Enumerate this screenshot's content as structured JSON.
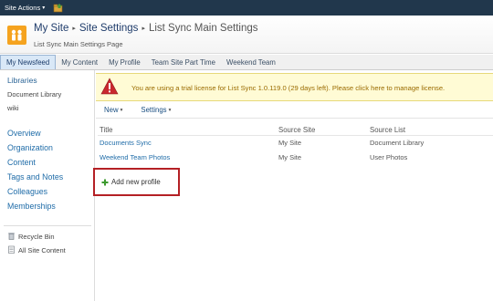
{
  "ribbon": {
    "site_actions": "Site Actions",
    "caret": "▾"
  },
  "header": {
    "breadcrumb": [
      "My Site",
      "Site Settings",
      "List Sync Main Settings"
    ],
    "separator": "▸",
    "subtitle": "List Sync Main Settings Page"
  },
  "topnav": {
    "tabs": [
      {
        "label": "My Newsfeed",
        "selected": true
      },
      {
        "label": "My Content",
        "selected": false
      },
      {
        "label": "My Profile",
        "selected": false
      },
      {
        "label": "Team Site Part Time",
        "selected": false
      },
      {
        "label": "Weekend Team",
        "selected": false
      }
    ]
  },
  "leftnav": {
    "libraries_heading": "Libraries",
    "libraries_items": [
      "Document Library",
      "wiki"
    ],
    "links": [
      "Overview",
      "Organization",
      "Content",
      "Tags and Notes",
      "Colleagues",
      "Memberships"
    ],
    "recycle_bin": "Recycle Bin",
    "all_site_content": "All Site Content"
  },
  "banner": {
    "text": "You are using a trial license for List Sync 1.0.119.0 (29 days left). Please click here to manage license."
  },
  "toolbar": {
    "new_label": "New",
    "settings_label": "Settings",
    "caret": "▾"
  },
  "list": {
    "columns": [
      "Title",
      "Source Site",
      "Source List"
    ],
    "rows": [
      {
        "title": "Documents Sync",
        "source_site": "My Site",
        "source_list": "Document Library"
      },
      {
        "title": "Weekend Team Photos",
        "source_site": "My Site",
        "source_list": "User Photos"
      }
    ]
  },
  "add_profile": {
    "label": "Add new profile"
  },
  "colors": {
    "ribbon_bg": "#21374c",
    "link": "#1f6ca8",
    "warning_text": "#9a6b00",
    "banner_bg": "#fffbd5",
    "highlight_border": "#b42025",
    "logo": "#f5a31f"
  },
  "icons": {
    "site_logo": "people-icon",
    "ribbon": "navigate-up-icon",
    "warning": "warning-icon",
    "add": "add-icon",
    "recycle_bin": "recycle-bin-icon",
    "all_site_content": "site-content-icon"
  }
}
